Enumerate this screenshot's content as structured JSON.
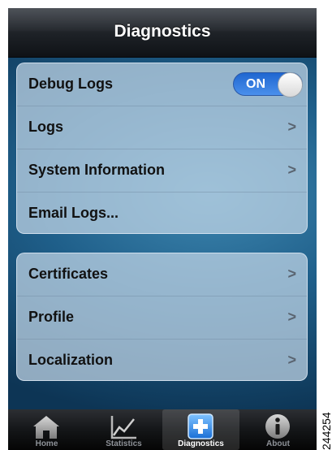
{
  "navbar": {
    "title": "Diagnostics"
  },
  "group1": {
    "rows": [
      {
        "label": "Debug Logs",
        "toggle": "ON",
        "toggle_on": true
      },
      {
        "label": "Logs",
        "chevron": ">"
      },
      {
        "label": "System Information",
        "chevron": ">"
      },
      {
        "label": "Email Logs..."
      }
    ]
  },
  "group2": {
    "rows": [
      {
        "label": "Certificates",
        "chevron": ">"
      },
      {
        "label": "Profile",
        "chevron": ">"
      },
      {
        "label": "Localization",
        "chevron": ">"
      }
    ]
  },
  "tabbar": {
    "tabs": [
      {
        "label": "Home",
        "icon": "home-icon"
      },
      {
        "label": "Statistics",
        "icon": "statistics-icon"
      },
      {
        "label": "Diagnostics",
        "icon": "diagnostics-icon",
        "selected": true
      },
      {
        "label": "About",
        "icon": "info-icon"
      }
    ]
  },
  "figure_id": "244254"
}
